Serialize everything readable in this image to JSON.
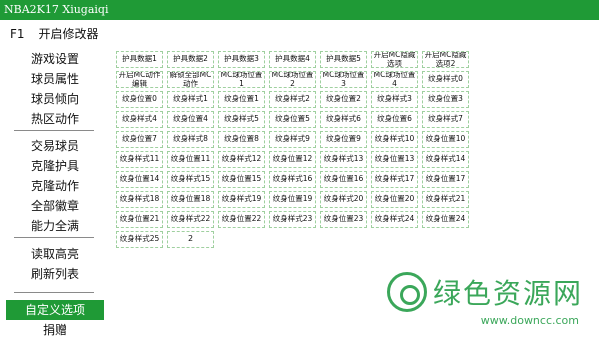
{
  "window": {
    "title": "NBA2K17 Xiugaiqi"
  },
  "hotkey": {
    "key": "F1",
    "label": "开启修改器"
  },
  "sidebar": {
    "group1": [
      "游戏设置",
      "球员属性",
      "球员倾向",
      "热区动作"
    ],
    "group2": [
      "交易球员",
      "克隆护具",
      "克隆动作",
      "全部徽章",
      "能力全满"
    ],
    "group3": [
      "读取高亮",
      "刷新列表"
    ],
    "group4": [
      {
        "label": "自定义选项",
        "active": true
      },
      {
        "label": "捐赠",
        "active": false
      }
    ]
  },
  "buttons": [
    "护具数据1",
    "护具数据2",
    "护具数据3",
    "护具数据4",
    "护具数据5",
    "开启MC隐藏\n选项",
    "开启MC隐藏\n选项2",
    "开启MC动作\n编辑",
    "解锁全部MC\n动作",
    "MC球场位置\n1",
    "MC球场位置\n2",
    "MC球场位置\n3",
    "MC球场位置\n4",
    "纹身样式0",
    "纹身位置0",
    "纹身样式1",
    "纹身位置1",
    "纹身样式2",
    "纹身位置2",
    "纹身样式3",
    "纹身位置3",
    "纹身样式4",
    "纹身位置4",
    "纹身样式5",
    "纹身位置5",
    "纹身样式6",
    "纹身位置6",
    "纹身样式7",
    "纹身位置7",
    "纹身样式8",
    "纹身位置8",
    "纹身样式9",
    "纹身位置9",
    "纹身样式10",
    "纹身位置10",
    "纹身样式11",
    "纹身位置11",
    "纹身样式12",
    "纹身位置12",
    "纹身样式13",
    "纹身位置13",
    "纹身样式14",
    "纹身位置14",
    "纹身样式15",
    "纹身位置15",
    "纹身样式16",
    "纹身位置16",
    "纹身样式17",
    "纹身位置17",
    "纹身样式18",
    "纹身位置18",
    "纹身样式19",
    "纹身位置19",
    "纹身样式20",
    "纹身位置20",
    "纹身样式21",
    "纹身位置21",
    "纹身样式22",
    "纹身位置22",
    "纹身样式23",
    "纹身位置23",
    "纹身样式24",
    "纹身位置24",
    "纹身样式25",
    "2"
  ],
  "watermark": {
    "text": "绿色资源网",
    "url": "www.downcc.com"
  },
  "colors": {
    "accent": "#1f9a36",
    "cell_border": "#9fd09f",
    "watermark": "#3ba75a"
  }
}
